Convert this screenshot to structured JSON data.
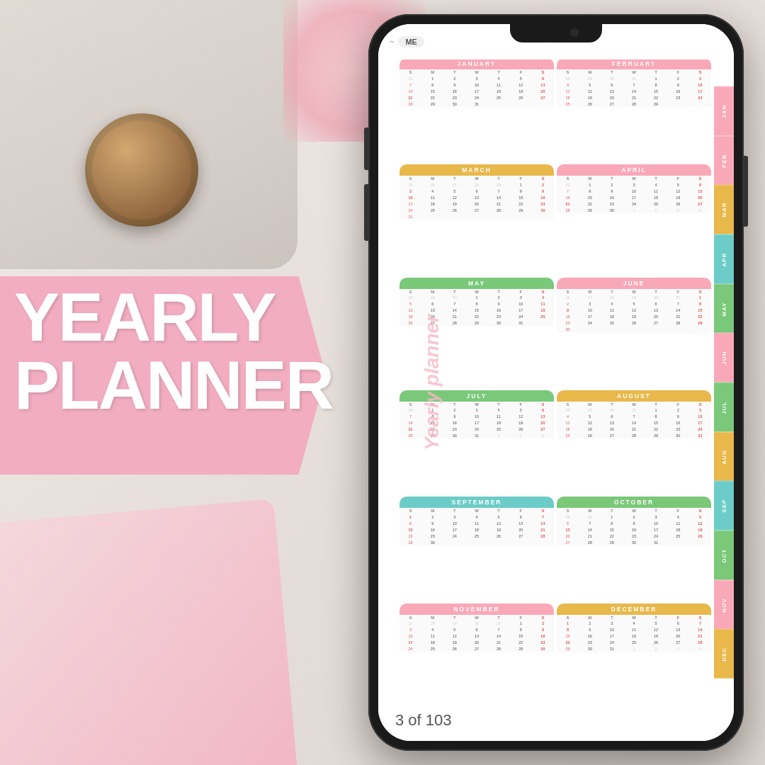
{
  "app": {
    "title": "Yearly Planner",
    "page_counter": "3 of 103"
  },
  "title": {
    "yearly": "YEARLY",
    "planner": "PLANNER"
  },
  "phone": {
    "topbar_label": "ME"
  },
  "months": [
    {
      "name": "JANUARY",
      "class": "jan",
      "tab": "JAN",
      "tab_class": "tab-jan"
    },
    {
      "name": "FEBRUARY",
      "class": "feb",
      "tab": "FEB",
      "tab_class": "tab-feb"
    },
    {
      "name": "MARCH",
      "class": "mar",
      "tab": "MAR",
      "tab_class": "tab-mar"
    },
    {
      "name": "APRIL",
      "class": "apr",
      "tab": "APR",
      "tab_class": "tab-apr"
    },
    {
      "name": "MAY",
      "class": "may",
      "tab": "MAY",
      "tab_class": "tab-may"
    },
    {
      "name": "JUNE",
      "class": "jun",
      "tab": "JUN",
      "tab_class": "tab-jun"
    },
    {
      "name": "JULY",
      "class": "jul",
      "tab": "JUL",
      "tab_class": "tab-jul"
    },
    {
      "name": "AUGUST",
      "class": "aug",
      "tab": "AUG",
      "tab_class": "tab-aug"
    },
    {
      "name": "SEPTEMBER",
      "class": "sep",
      "tab": "SEP",
      "tab_class": "tab-sep"
    },
    {
      "name": "OCTOBER",
      "class": "oct",
      "tab": "OCT",
      "tab_class": "tab-oct"
    },
    {
      "name": "NOVEMBER",
      "class": "nov",
      "tab": "NOV",
      "tab_class": "tab-nov"
    },
    {
      "name": "DECEMBER",
      "class": "dec",
      "tab": "DEC",
      "tab_class": "tab-dec"
    }
  ],
  "watermark": "Yearly planner",
  "day_headers": [
    "S",
    "M",
    "T",
    "W",
    "T",
    "F",
    "S"
  ]
}
